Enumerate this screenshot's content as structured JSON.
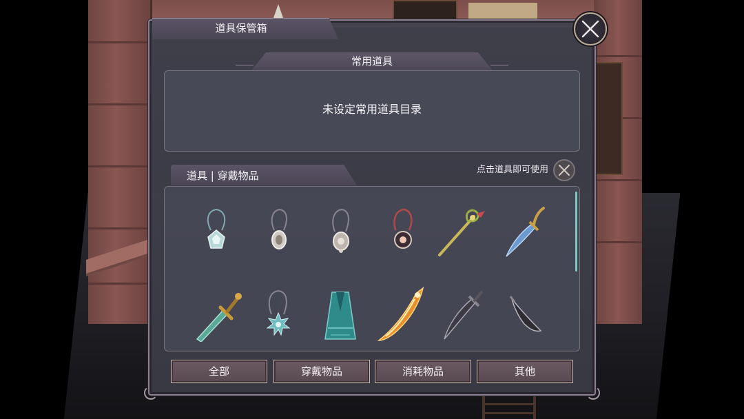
{
  "window": {
    "title": "道具保管箱"
  },
  "favorites": {
    "header": "常用道具",
    "empty_message": "未设定常用道具目录"
  },
  "items": {
    "tab_label": "道具 | 穿戴物品",
    "hint": "点击道具即可使用",
    "list": [
      {
        "icon": "pentagon-gem-amulet-icon"
      },
      {
        "icon": "silver-oval-pendant-icon"
      },
      {
        "icon": "ornate-silver-pendant-icon"
      },
      {
        "icon": "red-cord-sun-pendant-icon"
      },
      {
        "icon": "golden-vine-staff-icon"
      },
      {
        "icon": "blue-curved-dagger-icon"
      },
      {
        "icon": "jade-sword-icon"
      },
      {
        "icon": "spiked-star-pendant-icon"
      },
      {
        "icon": "teal-robe-icon"
      },
      {
        "icon": "flame-blade-icon"
      },
      {
        "icon": "dark-scimitar-icon"
      },
      {
        "icon": "black-sickle-blade-icon"
      }
    ]
  },
  "filters": [
    {
      "label": "全部"
    },
    {
      "label": "穿戴物品"
    },
    {
      "label": "消耗物品"
    },
    {
      "label": "其他"
    }
  ],
  "colors": {
    "panel": "#42424e",
    "accent_scroll": "#7fc6c4",
    "button": "#6b5a62"
  }
}
